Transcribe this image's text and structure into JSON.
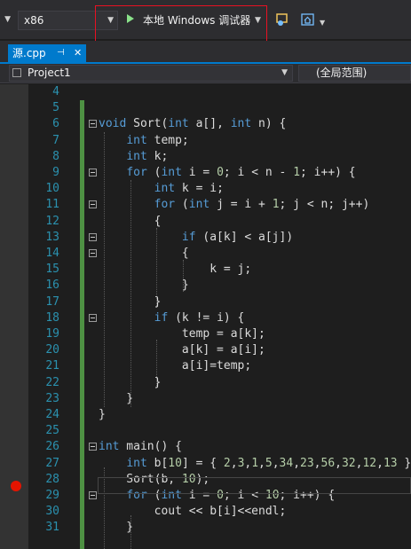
{
  "toolbar": {
    "platform": "x86",
    "run_label": "本地 Windows 调试器"
  },
  "tab": {
    "filename": "源.cpp",
    "pin": "⊣",
    "close": "✕"
  },
  "navbar": {
    "project": "Project1",
    "scope": "(全局范围)"
  },
  "colors": {
    "keyword": "#569cd6",
    "number": "#b5cea8",
    "linenum": "#2b91af",
    "accent": "#007acc",
    "breakpoint": "#e51400",
    "highlight_box": "#e81123"
  },
  "editor": {
    "breakpoint_line": "28",
    "lines": [
      {
        "n": "4",
        "t": ""
      },
      {
        "n": "5",
        "t": ""
      },
      {
        "n": "6",
        "t": "void Sort(int a[], int n) {"
      },
      {
        "n": "7",
        "t": "    int temp;"
      },
      {
        "n": "8",
        "t": "    int k;"
      },
      {
        "n": "9",
        "t": "    for (int i = 0; i < n - 1; i++) {"
      },
      {
        "n": "10",
        "t": "        int k = i;"
      },
      {
        "n": "11",
        "t": "        for (int j = i + 1; j < n; j++)"
      },
      {
        "n": "12",
        "t": "        {"
      },
      {
        "n": "13",
        "t": "            if (a[k] < a[j])"
      },
      {
        "n": "14",
        "t": "            {"
      },
      {
        "n": "15",
        "t": "                k = j;"
      },
      {
        "n": "16",
        "t": "            }"
      },
      {
        "n": "17",
        "t": "        }"
      },
      {
        "n": "18",
        "t": "        if (k != i) {"
      },
      {
        "n": "19",
        "t": "            temp = a[k];"
      },
      {
        "n": "20",
        "t": "            a[k] = a[i];"
      },
      {
        "n": "21",
        "t": "            a[i]=temp;"
      },
      {
        "n": "22",
        "t": "        }"
      },
      {
        "n": "23",
        "t": "    }"
      },
      {
        "n": "24",
        "t": "}"
      },
      {
        "n": "25",
        "t": ""
      },
      {
        "n": "26",
        "t": "int main() {"
      },
      {
        "n": "27",
        "t": "    int b[10] = { 2,3,1,5,34,23,56,32,12,13 };"
      },
      {
        "n": "28",
        "t": "    Sort(b, 10);"
      },
      {
        "n": "29",
        "t": "    for (int i = 0; i < 10; i++) {"
      },
      {
        "n": "30",
        "t": "        cout << b[i]<<endl;"
      },
      {
        "n": "31",
        "t": "    }"
      }
    ]
  }
}
